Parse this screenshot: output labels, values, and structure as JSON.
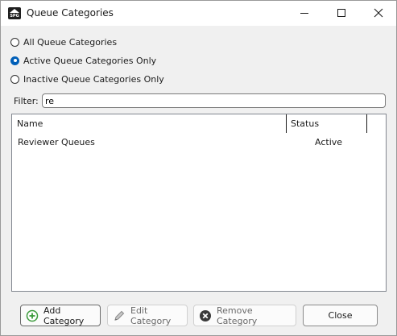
{
  "window": {
    "title": "Queue Categories",
    "app_icon_text": "SPG"
  },
  "filter_options": [
    {
      "label": "All Queue Categories",
      "checked": false
    },
    {
      "label": "Active Queue Categories Only",
      "checked": true
    },
    {
      "label": "Inactive Queue Categories Only",
      "checked": false
    }
  ],
  "filter": {
    "label": "Filter:",
    "value": "re"
  },
  "table": {
    "columns": [
      "Name",
      "Status"
    ],
    "rows": [
      {
        "name": "Reviewer Queues",
        "status": "Active"
      }
    ]
  },
  "buttons": {
    "add": "Add Category",
    "edit": "Edit Category",
    "remove": "Remove Category",
    "close": "Close"
  },
  "colors": {
    "accent": "#005fb8",
    "add_icon": "#3a9a3a"
  }
}
